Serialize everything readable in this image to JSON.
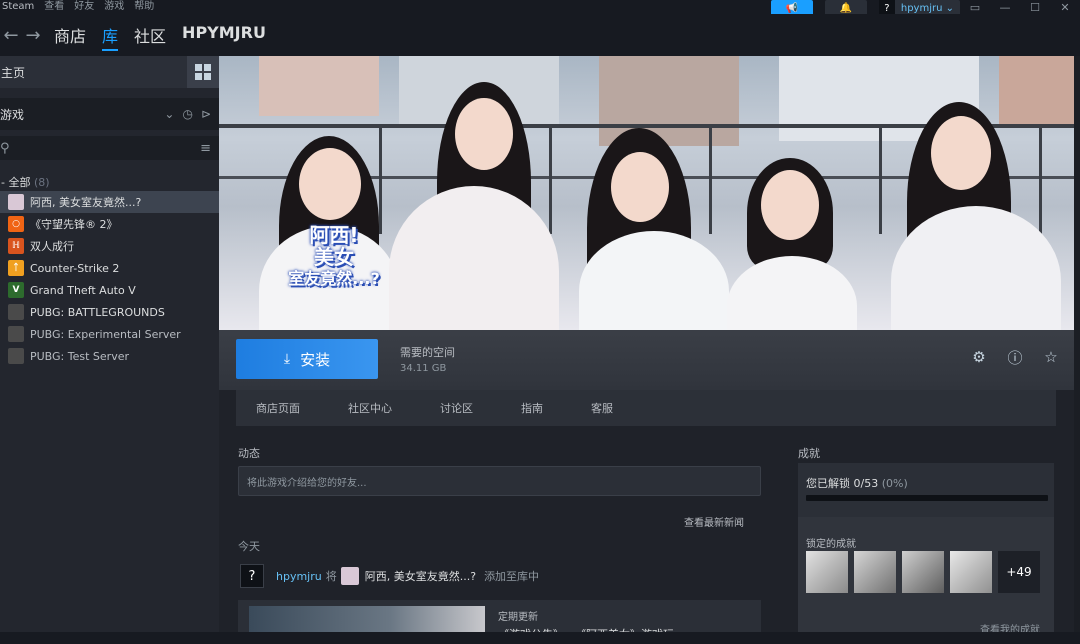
{
  "colors": {
    "accent": "#1a9fff",
    "background": "#171d25",
    "sidebar": "#23262e",
    "install": "#1e7de0"
  },
  "topbar": {
    "menu": [
      "Steam",
      "查看",
      "好友",
      "游戏",
      "帮助"
    ],
    "announce_icon": "megaphone-icon",
    "bell_icon": "bell-icon",
    "account_avatar": "?",
    "account_name": "hpymjru ⌄",
    "window_controls": [
      "minimize-icon",
      "maximize-icon",
      "close-icon"
    ]
  },
  "nav": {
    "back_icon": "←",
    "forward_icon": "→",
    "links": [
      "商店",
      "库",
      "社区",
      "HPYMJRU"
    ],
    "active_index": 1
  },
  "sidebar": {
    "home_label": "主页",
    "filter_label": "游戏",
    "filter_chevron": "⌄",
    "group_label": "- 全部",
    "group_count": "(8)",
    "games": [
      {
        "name": "阿西, 美女室友竟然...?",
        "icon_color": "#d9c8d6",
        "icon_char": "",
        "selected": true
      },
      {
        "name": "《守望先锋® 2》",
        "icon_color": "#f06414",
        "icon_char": "○"
      },
      {
        "name": "双人成行",
        "icon_color": "#d9541e",
        "icon_char": "ℍ"
      },
      {
        "name": "Counter-Strike 2",
        "icon_color": "#f0a020",
        "icon_char": "ᛏ"
      },
      {
        "name": "Grand Theft Auto V",
        "icon_color": "#2d6b2d",
        "icon_char": "V"
      },
      {
        "name": "PUBG: BATTLEGROUNDS",
        "icon_color": "#4a4a4a",
        "icon_char": ""
      },
      {
        "name": "PUBG: Experimental Server",
        "icon_color": "#4a4a4a",
        "icon_char": ""
      },
      {
        "name": "PUBG: Test Server",
        "icon_color": "#4a4a4a",
        "icon_char": ""
      }
    ]
  },
  "hero": {
    "logo_line1": "阿西!",
    "logo_line2": "美女",
    "logo_line3": "室友竟然...?"
  },
  "action": {
    "install_label": "安装",
    "space_label": "需要的空间",
    "space_value": "34.11 GB"
  },
  "tabs": [
    "商店页面",
    "社区中心",
    "讨论区",
    "指南",
    "客服"
  ],
  "activity": {
    "title": "动态",
    "placeholder": "将此游戏介绍给您的好友...",
    "news_link": "查看最新新闻",
    "today": "今天",
    "feed_avatar": "?",
    "feed_user": "hpymjru",
    "feed_verb": "将",
    "feed_game": "阿西, 美女室友竟然...?",
    "feed_action": "添加至库中",
    "news_tag": "定期更新",
    "news_title": "《游戏公告》 - 《阿西美女》游戏玩..."
  },
  "achievements": {
    "title": "成就",
    "unlocked_text": "您已解锁 0/53",
    "unlocked_pct": "(0%)",
    "progress": 0,
    "locked_label": "锁定的成就",
    "more": "+49",
    "view_link": "查看我的成就"
  }
}
